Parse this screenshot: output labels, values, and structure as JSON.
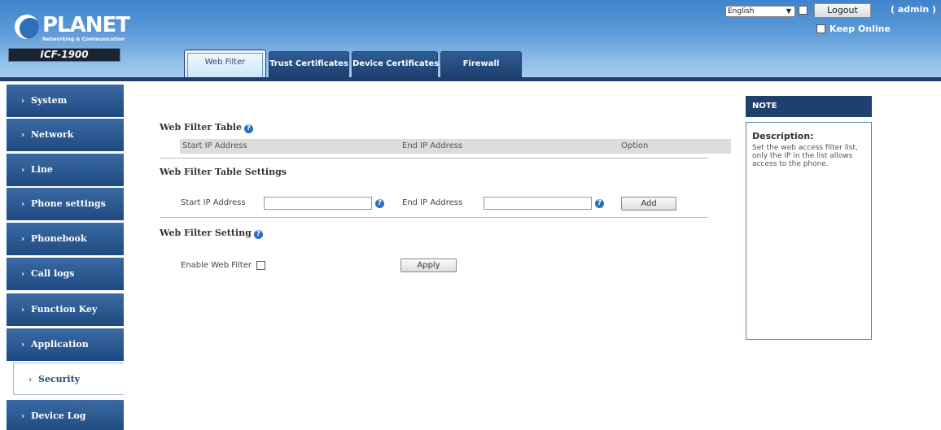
{
  "header": {
    "logo_text": "PLANET",
    "logo_subtitle": "Networking & Communication",
    "model": "ICF-1900",
    "language": "English",
    "logout_label": "Logout",
    "user_label": "( admin )",
    "keep_online_label": "Keep Online"
  },
  "tabs": [
    {
      "label": "Web Filter",
      "active": true
    },
    {
      "label": "Trust Certificates",
      "active": false
    },
    {
      "label": "Device Certificates",
      "active": false
    },
    {
      "label": "Firewall",
      "active": false
    }
  ],
  "sidebar": {
    "items": [
      {
        "label": "System"
      },
      {
        "label": "Network"
      },
      {
        "label": "Line"
      },
      {
        "label": "Phone settings"
      },
      {
        "label": "Phonebook"
      },
      {
        "label": "Call logs"
      },
      {
        "label": "Function Key"
      },
      {
        "label": "Application"
      },
      {
        "label": "Security",
        "active": true
      },
      {
        "label": "Device Log"
      }
    ]
  },
  "main": {
    "table_title": "Web Filter Table",
    "table_columns": [
      "Start IP Address",
      "End IP Address",
      "Option"
    ],
    "settings_title": "Web Filter Table Settings",
    "start_ip_label": "Start IP Address",
    "start_ip_value": "",
    "end_ip_label": "End IP Address",
    "end_ip_value": "",
    "add_label": "Add",
    "filter_setting_title": "Web Filter Setting",
    "enable_label": "Enable Web Filter",
    "enable_checked": false,
    "apply_label": "Apply"
  },
  "note": {
    "title": "NOTE",
    "desc_title": "Description:",
    "desc_text": "Set the web access filter list, only the IP in the list allows access to the phone."
  },
  "colors": {
    "header_blue": "#3f84cc",
    "dark_navy": "#1f3f6e",
    "sidebar_blue": "#2a5a94",
    "help_icon": "#2a6fc0"
  },
  "icons": {
    "help": "question-circle-icon",
    "chevron": "chevron-right-icon",
    "dropdown": "chevron-down-icon"
  }
}
